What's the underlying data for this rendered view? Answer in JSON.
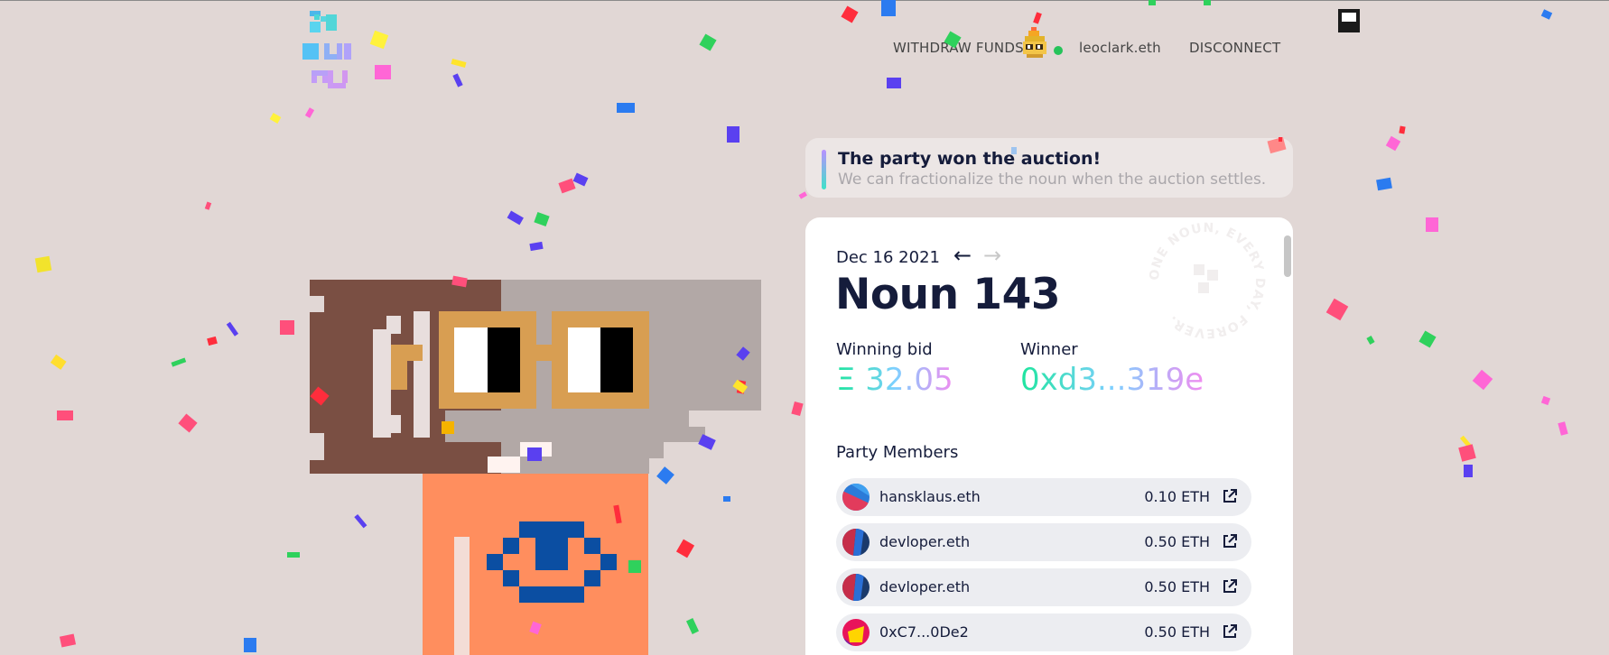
{
  "nav": {
    "withdraw_label": "WITHDRAW FUNDS",
    "account_label": "leoclark.eth",
    "disconnect_label": "DISCONNECT",
    "status_color": "#26c35a"
  },
  "notice": {
    "title": "The party won the auction!",
    "subtitle": "We can fractionalize the noun when the auction settles."
  },
  "auction": {
    "date": "Dec 16 2021",
    "prev_icon": "arrow-left-icon",
    "next_icon": "arrow-right-icon",
    "noun_title": "Noun 143",
    "winning_bid_label": "Winning bid",
    "winning_bid_value": "Ξ 32.05",
    "winner_label": "Winner",
    "winner_value": "0xd3...319e",
    "stamp_text": "ONE NOUN, EVERY DAY, FOREVER."
  },
  "party": {
    "label": "Party Members",
    "members": [
      {
        "name": "hansklaus.eth",
        "amount": "0.10 ETH"
      },
      {
        "name": "devloper.eth",
        "amount": "0.50 ETH"
      },
      {
        "name": "devloper.eth",
        "amount": "0.50 ETH"
      },
      {
        "name": "0xC7...0De2",
        "amount": "0.50 ETH"
      }
    ]
  },
  "colors": {
    "background": "#e1d7d5",
    "card": "#ffffff",
    "text": "#151c3b",
    "accent_gradient": [
      "#1ee59e",
      "#7ed0ff",
      "#f08cf0"
    ]
  }
}
